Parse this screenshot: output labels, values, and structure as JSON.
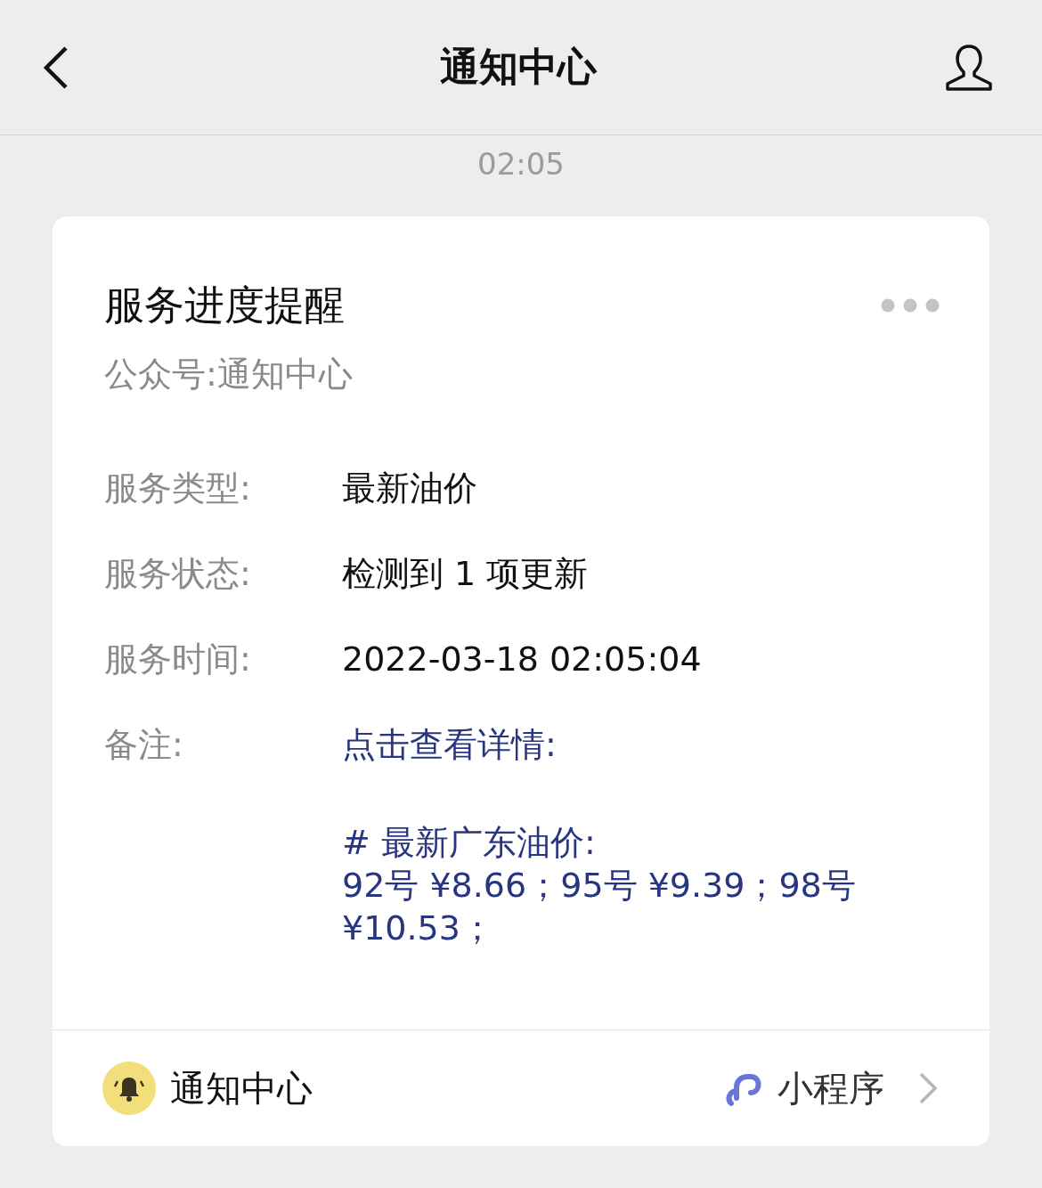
{
  "nav": {
    "title": "通知中心"
  },
  "timestamp": "02:05",
  "card": {
    "title": "服务进度提醒",
    "source": "公众号:通知中心",
    "fields": [
      {
        "label": "服务类型:",
        "kind": "text",
        "value": "最新油价"
      },
      {
        "label": "服务状态:",
        "kind": "text",
        "value": "检测到 1 项更新"
      },
      {
        "label": "服务时间:",
        "kind": "text",
        "value": "2022-03-18 02:05:04"
      },
      {
        "label": "备注:",
        "kind": "link",
        "value": "点击查看详情:",
        "note": [
          "# 最新广东油价:",
          "92号 ¥8.66；95号 ¥9.39；98号 ¥10.53；"
        ]
      }
    ],
    "footer": {
      "account": "通知中心",
      "mini_program": "小程序"
    }
  }
}
